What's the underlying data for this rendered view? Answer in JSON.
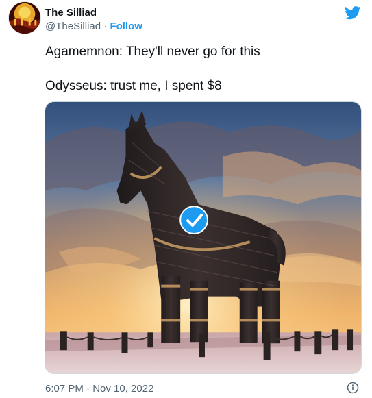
{
  "author": {
    "display_name": "The Silliad",
    "handle": "@TheSilliad",
    "separator": " · ",
    "follow_label": "Follow",
    "avatar_icon": "silliad-avatar-icon"
  },
  "tweet": {
    "lines": [
      "Agamemnon: They'll never go for this",
      "Odysseus: trust me, I spent $8"
    ],
    "media_description_icon": "trojan-horse-verified-image",
    "timestamp": "6:07 PM · Nov 10, 2022"
  },
  "icons": {
    "brand": "twitter-bird-icon",
    "info": "info-icon",
    "verified": "verified-badge-icon"
  },
  "colors": {
    "accent": "#1d9bf0",
    "text": "#0f1419",
    "secondary": "#536471"
  }
}
